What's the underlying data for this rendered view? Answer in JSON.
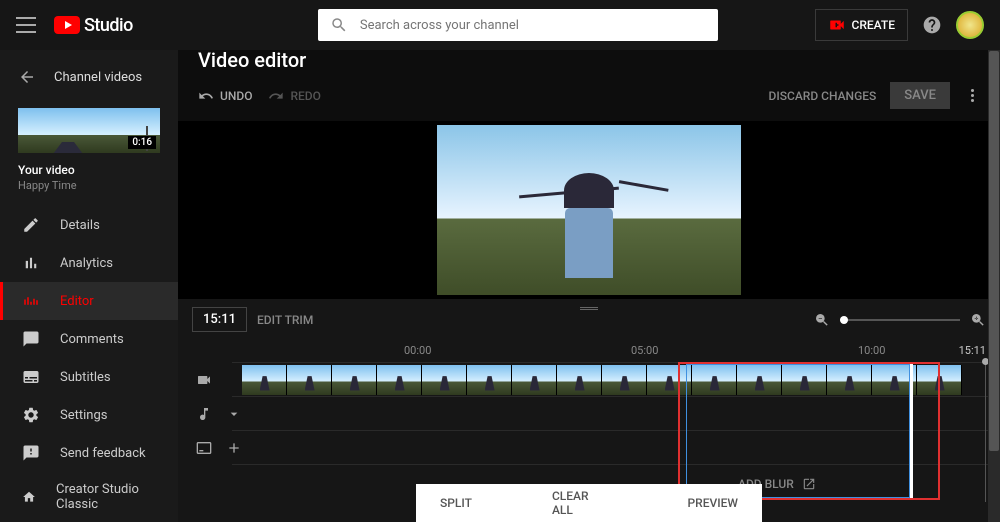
{
  "header": {
    "logo_text": "Studio",
    "search_placeholder": "Search across your channel",
    "create_label": "CREATE"
  },
  "sidebar": {
    "back_label": "Channel videos",
    "thumb_duration": "0:16",
    "video_heading": "Your video",
    "video_title": "Happy Time",
    "nav": [
      {
        "label": "Details"
      },
      {
        "label": "Analytics"
      },
      {
        "label": "Editor"
      },
      {
        "label": "Comments"
      },
      {
        "label": "Subtitles"
      }
    ],
    "footer": [
      {
        "label": "Settings"
      },
      {
        "label": "Send feedback"
      },
      {
        "label": "Creator Studio Classic"
      }
    ]
  },
  "editor": {
    "title": "Video editor",
    "undo": "UNDO",
    "redo": "REDO",
    "discard": "DISCARD CHANGES",
    "save": "SAVE",
    "timecode": "15:11",
    "edit_trim": "EDIT TRIM",
    "ruler": {
      "m0": "00:00",
      "m1": "05:00",
      "m2": "10:00",
      "end": "15:11"
    },
    "add_blur": "ADD BLUR",
    "bottom": {
      "split": "SPLIT",
      "clear": "CLEAR ALL",
      "preview": "PREVIEW"
    }
  }
}
